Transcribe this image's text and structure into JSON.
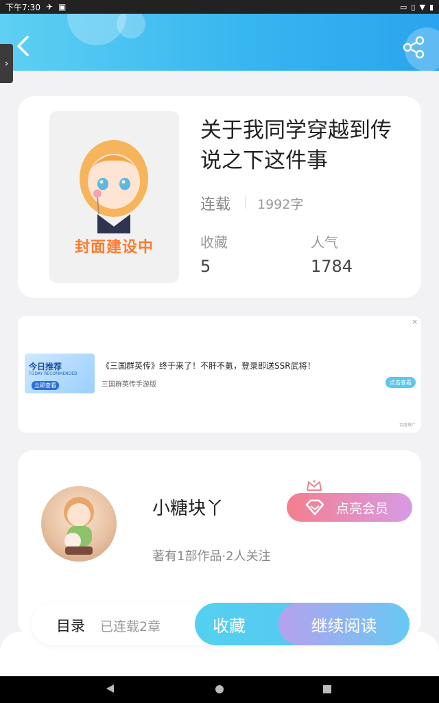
{
  "statusbar": {
    "time": "下午7:30",
    "icons": [
      "notification-icon",
      "bag-icon",
      "cast-icon",
      "vibrate-icon",
      "wifi-icon",
      "battery-icon"
    ]
  },
  "header": {
    "back_icon": "chevron-left-icon",
    "share_icon": "share-icon"
  },
  "book": {
    "cover_placeholder": "封面建设中",
    "title": "关于我同学穿越到传说之下这件事",
    "status": "连载",
    "word_count": "1992字",
    "favorites_label": "收藏",
    "favorites_value": "5",
    "popularity_label": "人气",
    "popularity_value": "1784"
  },
  "ad": {
    "image_text_main": "今日推荐",
    "image_text_sub": "TODAY RECOMMENDED",
    "image_button": "立即查看",
    "title": "《三国群英传》终于来了！不肝不氪，登录即送SSR武将！",
    "subtitle": "三国群英传手游版",
    "button": "点击查看",
    "close": "×",
    "tag": "百度推广"
  },
  "author": {
    "name": "小糖块丫",
    "meta": "著有1部作品·2人关注",
    "vip_button": "点亮会员"
  },
  "bottom": {
    "toc_label": "目录",
    "chapters": "已连载2章",
    "favorite_button": "收藏",
    "read_button": "继续阅读"
  },
  "colors": {
    "header_start": "#5fd0f3",
    "header_end": "#2aa4ee",
    "cover_text": "#ff7a2e",
    "vip_start": "#f47f8e",
    "vip_end": "#d79ae6",
    "read_start": "#b6a1ee",
    "read_end": "#66c9f3"
  }
}
